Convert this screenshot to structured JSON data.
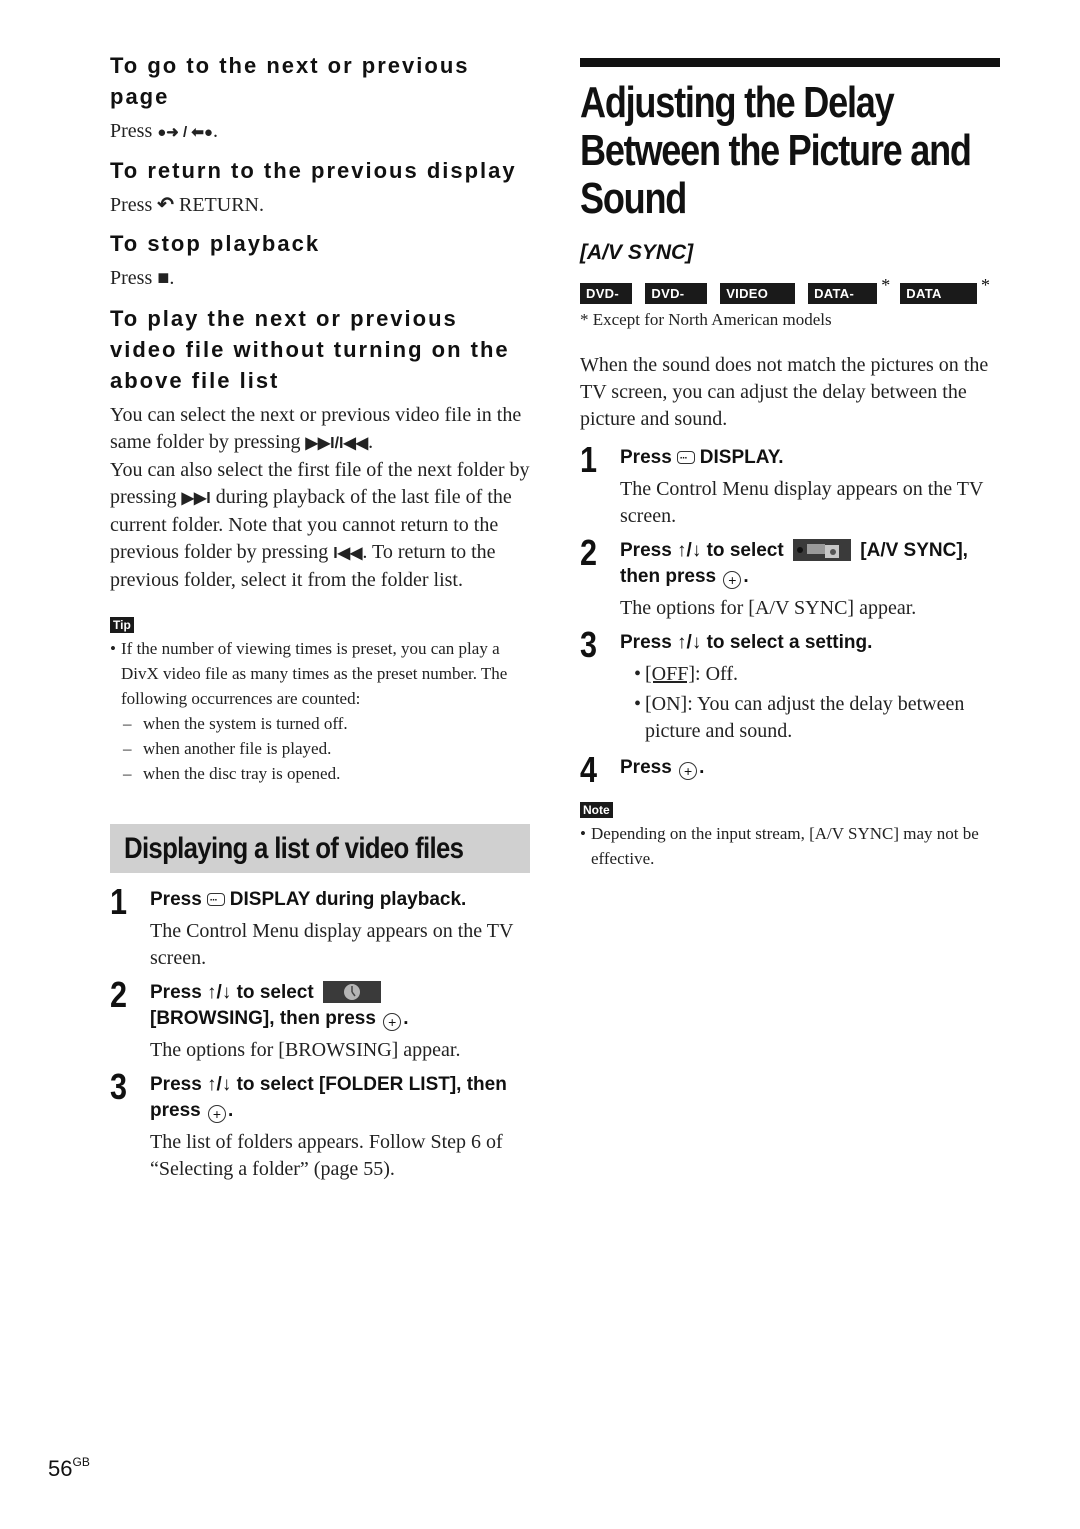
{
  "left_column": {
    "next_prev_page": {
      "heading": "To go to the next or previous page",
      "text_before": "Press",
      "icon": "next-prev-page-arrows-icon",
      "icon_glyph": "●➜ / ⬅●",
      "text_after": "."
    },
    "return_display": {
      "heading": "To return to the previous display",
      "text_before": "Press",
      "icon": "return-arrow-icon",
      "icon_glyph": "↶",
      "text_after": "RETURN."
    },
    "stop_playback": {
      "heading": "To stop playback",
      "text_before": "Press",
      "icon": "stop-icon",
      "icon_glyph": "■",
      "text_after": "."
    },
    "play_next_prev": {
      "heading": "To play the next or previous video file without turning on the above file list",
      "para1_a": "You can select the next or previous video file in the same folder by pressing",
      "para1_icon": "▶▶I/I◀◀",
      "para1_b": ".",
      "para2_a": "You can also select the first file of the next folder by pressing",
      "para2_icon1": "▶▶I",
      "para2_b": "during playback of the last file of the current folder. Note that you cannot return to the previous folder by pressing",
      "para2_icon2": "I◀◀",
      "para2_c": ". To return to the previous folder, select it from the folder list."
    },
    "tip": {
      "label": "Tip",
      "bullet": "If the number of viewing times is preset, you can play a DivX video file as many times as the preset number. The following occurrences are counted:",
      "dashes": [
        "when the system is turned off.",
        "when another file is played.",
        "when the disc tray is opened."
      ]
    },
    "section": {
      "title": "Displaying a list of video files",
      "steps": [
        {
          "num": "1",
          "title_a": "Press",
          "title_b": "DISPLAY during playback.",
          "desc": "The Control Menu display appears on the TV screen."
        },
        {
          "num": "2",
          "title_a": "Press ↑/↓ to select",
          "title_b": "[BROWSING], then press",
          "title_c": ".",
          "desc": "The options for [BROWSING] appear."
        },
        {
          "num": "3",
          "title_a": "Press ↑/↓ to select [FOLDER LIST], then press",
          "title_c": ".",
          "desc": "The list of folders appears. Follow Step 6 of “Selecting a folder” (page 55)."
        }
      ]
    }
  },
  "right_column": {
    "title": "Adjusting the Delay Between the Picture and Sound",
    "subtitle": "[A/V SYNC]",
    "discs": [
      {
        "label": "DVD-V",
        "starred": false
      },
      {
        "label": "DVD-VR",
        "starred": false
      },
      {
        "label": "VIDEO CD",
        "starred": false
      },
      {
        "label": "DATA-CD",
        "starred": true
      },
      {
        "label": "DATA DVD",
        "starred": true
      }
    ],
    "star": "*",
    "footnote": "*   Except for North American models",
    "intro": "When the sound does not match the pictures on the TV screen, you can adjust the delay between the picture and sound.",
    "steps": [
      {
        "num": "1",
        "title_a": "Press",
        "title_b": "DISPLAY.",
        "desc": "The Control Menu display appears on the TV screen."
      },
      {
        "num": "2",
        "title_a": "Press ↑/↓ to select",
        "title_b": "[A/V SYNC],",
        "title_c": "then press",
        "title_d": ".",
        "desc": "The options for [A/V SYNC] appear."
      },
      {
        "num": "3",
        "title_a": "Press ↑/↓ to select a setting.",
        "options": [
          {
            "key": "[OFF]",
            "text": ": Off.",
            "default": true
          },
          {
            "key": "[ON]",
            "text": ": You can adjust the delay between picture and sound.",
            "default": false
          }
        ]
      },
      {
        "num": "4",
        "title_a": "Press",
        "title_c": "."
      }
    ],
    "note": {
      "label": "Note",
      "bullet": "Depending on the input stream, [A/V SYNC] may not be effective."
    }
  },
  "page": {
    "number": "56",
    "suffix": "GB"
  },
  "icons": {
    "enter": "+"
  }
}
